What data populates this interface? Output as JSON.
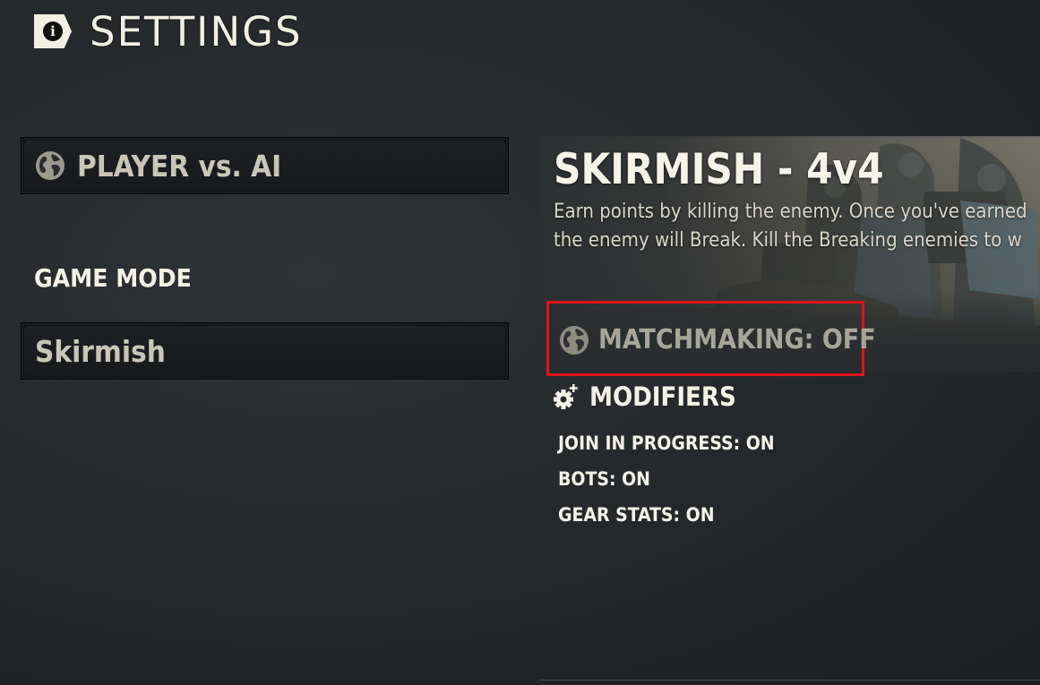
{
  "header": {
    "title": "SETTINGS",
    "icon": "info-icon"
  },
  "left": {
    "playlist": {
      "label": "PLAYER vs. AI",
      "icon": "globe-icon"
    },
    "game_mode_label": "GAME MODE",
    "game_mode": {
      "value": "Skirmish"
    }
  },
  "detail": {
    "title": "SKIRMISH - 4v4",
    "description_lines": [
      "Earn points by killing the enemy. Once you've earned",
      "the enemy will Break. Kill the Breaking enemies to w"
    ],
    "matchmaking": {
      "label": "MATCHMAKING: OFF",
      "icon": "globe-icon",
      "highlight_color": "#e0121b"
    },
    "modifiers": {
      "title": "MODIFIERS",
      "icon": "gear-plus-icon",
      "items": [
        "JOIN IN PROGRESS: ON",
        "BOTS: ON",
        "GEAR STATS: ON"
      ]
    }
  },
  "colors": {
    "background": "#26292c",
    "text_primary": "#f4f1e8",
    "text_muted": "#a8a59a",
    "highlight": "#e0121b"
  }
}
